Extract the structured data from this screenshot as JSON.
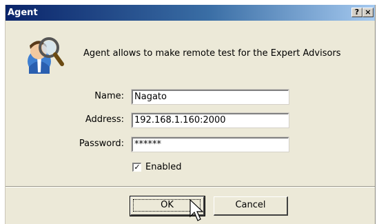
{
  "window": {
    "title": "Agent",
    "help_label": "?",
    "close_label": "×"
  },
  "description": "Agent allows to make remote test for the Expert Advisors",
  "form": {
    "name_label": "Name:",
    "name_value": "Nagato",
    "address_label": "Address:",
    "address_value": "192.168.1.160:2000",
    "password_label": "Password:",
    "password_value": "******",
    "enabled_label": "Enabled",
    "enabled_checked": true,
    "check_glyph": "✓"
  },
  "buttons": {
    "ok_label": "OK",
    "cancel_label": "Cancel"
  },
  "icons": {
    "agent": "agent-magnifier-icon",
    "cursor": "mouse-pointer-icon"
  },
  "colors": {
    "title_gradient_start": "#0a246a",
    "title_gradient_end": "#a6caf0",
    "dialog_background": "#ece9d8"
  }
}
